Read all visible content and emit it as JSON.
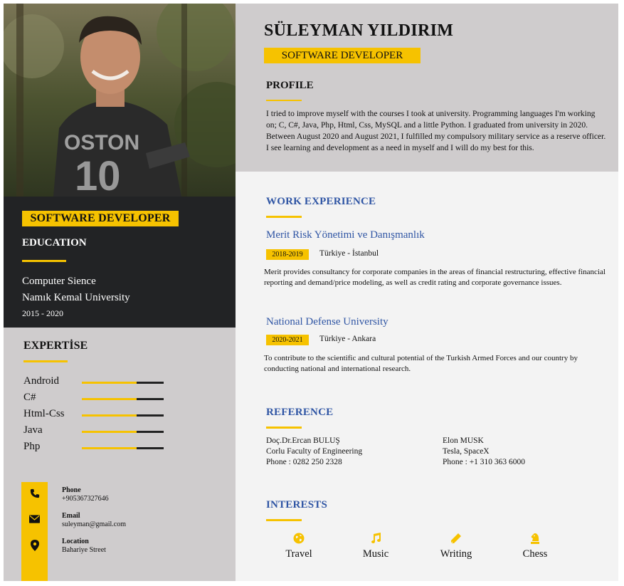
{
  "header": {
    "name": "SÜLEYMAN YILDIRIM",
    "role": "SOFTWARE DEVELOPER"
  },
  "profile": {
    "title": "PROFILE",
    "text": "I tried to improve myself with the courses I took at university. Programming languages I'm working on; C, C#, Java, Php, Html, Css, MySQL and a little Python. I graduated from university in 2020. Between August 2020 and August 2021, I fulfilled my compulsory military service as a reserve officer. I see learning and development as a need in myself and I will do my best for this."
  },
  "sidebar": {
    "role": "SOFTWARE DEVELOPER",
    "education": {
      "title": "EDUCATION",
      "degree": "Computer Sience",
      "school": "Namık Kemal University",
      "years": "2015 - 2020"
    },
    "expertise": {
      "title": "EXPERTİSE",
      "skills": [
        {
          "name": "Android",
          "level": 0.67
        },
        {
          "name": "C#",
          "level": 0.67
        },
        {
          "name": "Html-Css",
          "level": 0.67
        },
        {
          "name": "Java",
          "level": 0.67
        },
        {
          "name": "Php",
          "level": 0.67
        }
      ]
    },
    "contact": {
      "phone_label": "Phone",
      "phone": "+905367327646",
      "email_label": "Email",
      "email": "suleyman@gmail.com",
      "location_label": "Location",
      "location": "Bahariye Street"
    }
  },
  "work": {
    "title": "WORK EXPERIENCE",
    "jobs": [
      {
        "company": "Merit Risk Yönetimi ve Danışmanlık",
        "dates": "2018-2019",
        "location": "Türkiye - İstanbul",
        "description": "Merit provides consultancy for corporate companies in the areas of financial restructuring, effective financial reporting and demand/price modeling, as well as credit rating and corporate governance issues."
      },
      {
        "company": "National Defense University",
        "dates": "2020-2021",
        "location": "Türkiye - Ankara",
        "description": "To contribute to the scientific and cultural potential of the Turkish Armed Forces and our country by conducting national and international research."
      }
    ]
  },
  "reference": {
    "title": "REFERENCE",
    "people": [
      {
        "name": "Doç.Dr.Ercan BULUŞ",
        "org": "Corlu Faculty of Engineering",
        "phone": "Phone : 0282 250 2328"
      },
      {
        "name": "Elon MUSK",
        "org": "Tesla, SpaceX",
        "phone": "Phone : +1 310 363 6000"
      }
    ]
  },
  "interests": {
    "title": "INTERESTS",
    "items": [
      {
        "label": "Travel",
        "icon": "globe-icon"
      },
      {
        "label": "Music",
        "icon": "music-note-icon"
      },
      {
        "label": "Writing",
        "icon": "pencil-icon"
      },
      {
        "label": "Chess",
        "icon": "chess-knight-icon"
      }
    ]
  },
  "colors": {
    "accent": "#f6c200",
    "heading_blue": "#2f55a4",
    "sidebar_dark": "#222325",
    "panel_gray": "#cfcccd"
  }
}
